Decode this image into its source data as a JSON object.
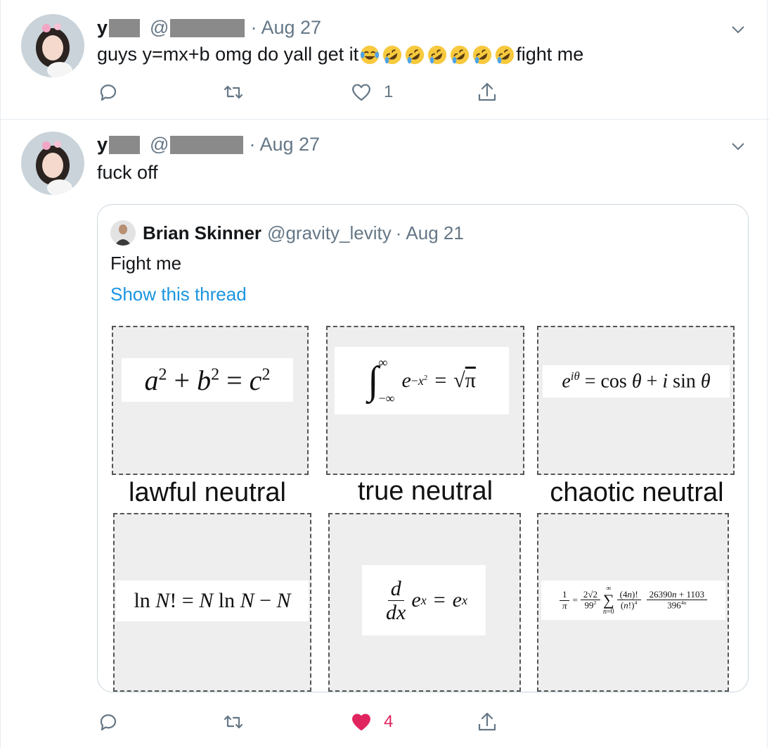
{
  "tweet1": {
    "name_initial": "y",
    "handle_prefix": "@",
    "dot": "·",
    "date": "Aug 27",
    "text": "guys y=mx+b omg do yall get it",
    "text_suffix": "fight me",
    "emoji_count_laugh": 1,
    "emoji_count_rofl": 6,
    "like_count": "1"
  },
  "tweet2": {
    "name_initial": "y",
    "handle_prefix": "@",
    "dot": "·",
    "date": "Aug 27",
    "text": "fuck off",
    "like_count": "4",
    "liked": true
  },
  "quote": {
    "name": "Brian Skinner",
    "handle": "@gravity_levity",
    "dot": "·",
    "date": "Aug 21",
    "text": "Fight me",
    "thread_link": "Show this thread",
    "meme": {
      "captions": [
        "lawful neutral",
        "true neutral",
        "chaotic neutral"
      ],
      "formula_pythagoras": "a² + b² = c²",
      "formula_gaussian": "∫ e^(−x²) = √π",
      "formula_euler": "e^(iθ) = cos θ + i sin θ",
      "formula_stirling": "ln N! = N ln N − N",
      "formula_derivative": "d/dx e^x = e^x",
      "formula_ramanujan": "1/π = (2√2/99²) Σ (4n)!/(n!)⁴ (26390n+1103)/396^(4n)"
    }
  },
  "colors": {
    "like_red": "#e0245e",
    "link_blue": "#1b95e0",
    "muted": "#657786",
    "border": "#e6ecf0"
  },
  "icons": [
    "chevron-down-icon",
    "reply-icon",
    "retweet-icon",
    "heart-icon",
    "share-icon"
  ]
}
